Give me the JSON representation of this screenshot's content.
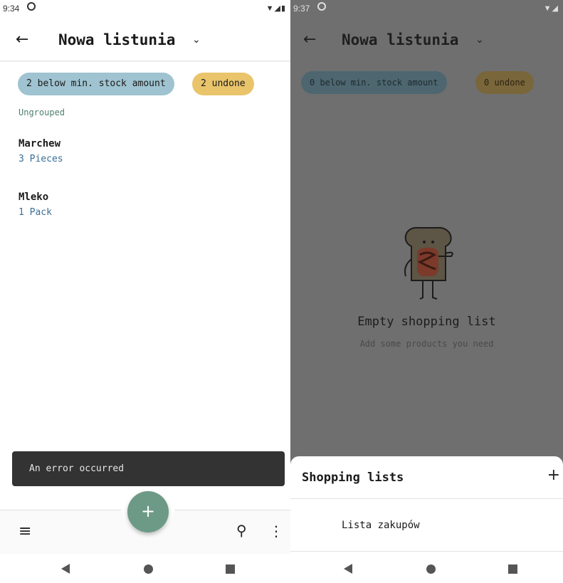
{
  "left": {
    "status": {
      "time": "9:34",
      "icons": "▼◢▮"
    },
    "app_bar": {
      "title": "Nowa listunia",
      "back_icon": "←",
      "chevron_icon": "⌄"
    },
    "chips": {
      "below_min": "2 below min. stock amount",
      "undone": "2 undone"
    },
    "section": "Ungrouped",
    "items": [
      {
        "name": "Marchew",
        "qty": "3 Pieces"
      },
      {
        "name": "Mleko",
        "qty": "1 Pack"
      }
    ],
    "snackbar": "An error occurred",
    "fab_icon": "+",
    "bottom_icons": {
      "menu": "≡",
      "search": "⚲",
      "more": "⋮"
    }
  },
  "right": {
    "status": {
      "time": "9:37",
      "icons": "▼◢"
    },
    "app_bar": {
      "title": "Nowa listunia",
      "back_icon": "←",
      "chevron_icon": "⌄"
    },
    "chips": {
      "below_min": "0 below min. stock amount",
      "undone": "0 undone"
    },
    "empty": {
      "title": "Empty shopping list",
      "subtitle": "Add some products you need"
    },
    "sheet": {
      "title": "Shopping lists",
      "add_icon": "+",
      "items": [
        "Lista zakupów"
      ]
    }
  },
  "colors": {
    "chip_blue": "#9fc3d0",
    "chip_yellow": "#e9c46a",
    "fab": "#6d9a86",
    "snackbar": "#333333",
    "scrim": "#6f6f6f"
  }
}
